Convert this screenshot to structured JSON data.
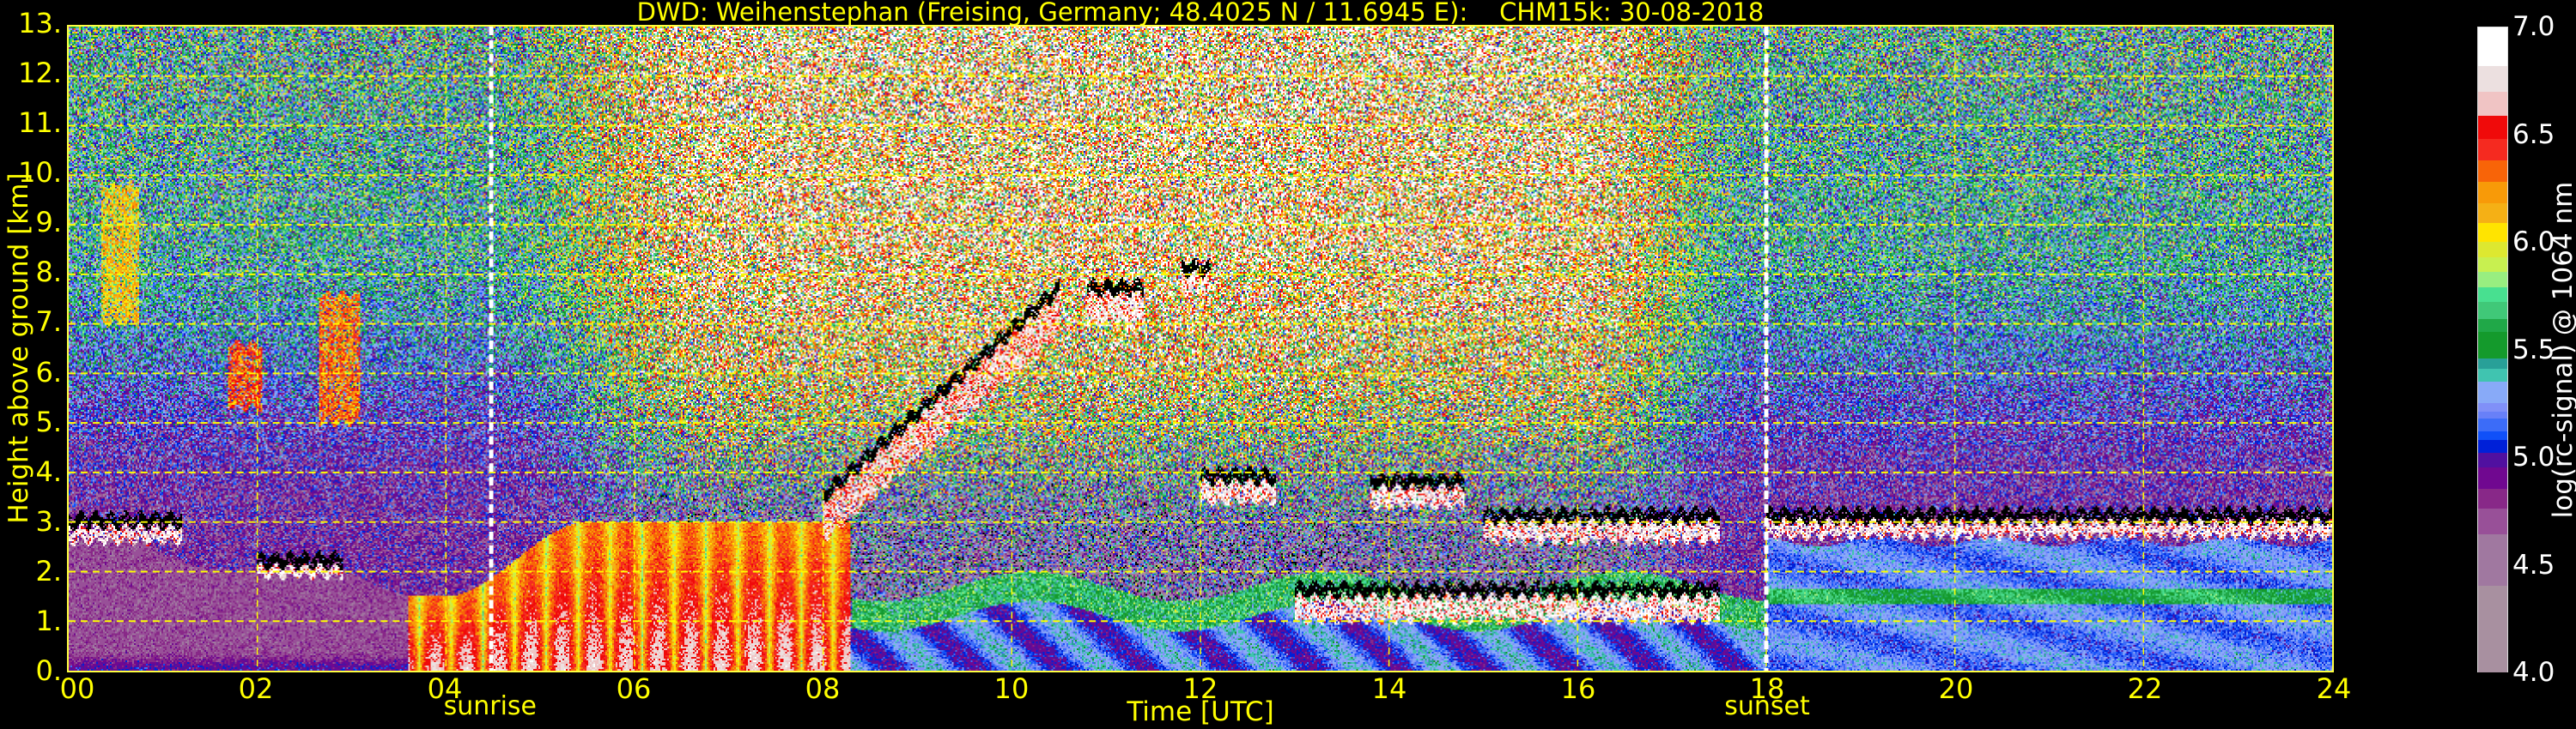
{
  "chart_data": {
    "type": "heatmap",
    "title": "DWD: Weihenstephan (Freising, Germany; 48.4025 N / 11.6945 E):    CHM15k: 30-08-2018",
    "xlabel": "Time [UTC]",
    "ylabel": "Height above ground [km]",
    "xlim": [
      0,
      24
    ],
    "ylim": [
      0,
      13
    ],
    "x_ticks": [
      0,
      2,
      4,
      6,
      8,
      10,
      12,
      14,
      16,
      18,
      20,
      22,
      24
    ],
    "x_tick_labels": [
      "00",
      "02",
      "04",
      "06",
      "08",
      "10",
      "12",
      "14",
      "16",
      "18",
      "20",
      "22",
      "24"
    ],
    "y_ticks": [
      0,
      1,
      2,
      3,
      4,
      5,
      6,
      7,
      8,
      9,
      10,
      11,
      12,
      13
    ],
    "y_tick_labels": [
      "0.",
      "1.",
      "2.",
      "3.",
      "4.",
      "5.",
      "6.",
      "7.",
      "8.",
      "9.",
      "10.",
      "11.",
      "12.",
      "13."
    ],
    "grid": true,
    "grid_color": "#ffff00",
    "annotations": [
      {
        "label": "sunrise",
        "time": 4.48,
        "color": "#ffffff"
      },
      {
        "label": "sunset",
        "time": 18.0,
        "color": "#ffffff"
      }
    ],
    "colorbar": {
      "label": "log(rc-signal) @ 1064 nm",
      "range": [
        4.0,
        7.0
      ],
      "ticks": [
        4.0,
        4.5,
        5.0,
        5.5,
        6.0,
        6.5,
        7.0
      ],
      "tick_labels": [
        "4.0",
        "4.5",
        "5.0",
        "5.5",
        "6.0",
        "6.5",
        "7.0"
      ],
      "boundaries": [
        7.0,
        6.82,
        6.7,
        6.59,
        6.48,
        6.38,
        6.28,
        6.18,
        6.09,
        6.0,
        5.93,
        5.86,
        5.79,
        5.72,
        5.64,
        5.58,
        5.46,
        5.41,
        5.35,
        5.25,
        5.21,
        5.18,
        5.12,
        5.08,
        5.02,
        4.95,
        4.85,
        4.76,
        4.64,
        4.4,
        4.0
      ],
      "colors": [
        "#ffffff",
        "#ece0e0",
        "#f0c4c4",
        "#f00a0a",
        "#f52a20",
        "#f86408",
        "#f89a08",
        "#f5b015",
        "#ffe400",
        "#dde830",
        "#c8f050",
        "#98ee80",
        "#48e090",
        "#40c878",
        "#20a848",
        "#149a2c",
        "#28a098",
        "#40c4b0",
        "#88aaf8",
        "#8090f8",
        "#6880f8",
        "#3c6cf8",
        "#1050f8",
        "#0020d8",
        "#5010a0",
        "#700890",
        "#882888",
        "#985098",
        "#a078a0",
        "#a890a0"
      ]
    },
    "cloud_layers": [
      {
        "t0": 0.0,
        "t1": 1.2,
        "h0": 2.6,
        "h1": 2.9,
        "value": 7.0
      },
      {
        "t0": 2.0,
        "t1": 2.9,
        "h0": 1.9,
        "h1": 2.1,
        "value": 7.0
      },
      {
        "t0": 0.35,
        "t1": 0.75,
        "h0": 7.0,
        "h1": 9.8,
        "value": 6.3
      },
      {
        "t0": 1.7,
        "t1": 2.05,
        "h0": 5.3,
        "h1": 6.6,
        "value": 6.6
      },
      {
        "t0": 2.65,
        "t1": 3.1,
        "h0": 5.0,
        "h1": 7.6,
        "value": 6.5
      },
      {
        "t0": 8.0,
        "t1": 10.5,
        "h0": 3.0,
        "h1": 7.2,
        "value": 6.9
      },
      {
        "t0": 10.8,
        "t1": 11.4,
        "h0": 7.0,
        "h1": 7.6,
        "value": 7.0
      },
      {
        "t0": 11.8,
        "t1": 12.1,
        "h0": 7.6,
        "h1": 8.0,
        "value": 7.0
      },
      {
        "t0": 12.0,
        "t1": 12.8,
        "h0": 3.4,
        "h1": 3.8,
        "value": 7.0
      },
      {
        "t0": 13.8,
        "t1": 14.8,
        "h0": 3.3,
        "h1": 3.7,
        "value": 7.0
      },
      {
        "t0": 15.0,
        "t1": 17.5,
        "h0": 2.6,
        "h1": 3.0,
        "value": 7.0
      },
      {
        "t0": 13.0,
        "t1": 17.5,
        "h0": 1.0,
        "h1": 1.5,
        "value": 7.0
      },
      {
        "t0": 18.0,
        "t1": 24.0,
        "h0": 2.7,
        "h1": 3.0,
        "value": 7.0
      }
    ]
  }
}
